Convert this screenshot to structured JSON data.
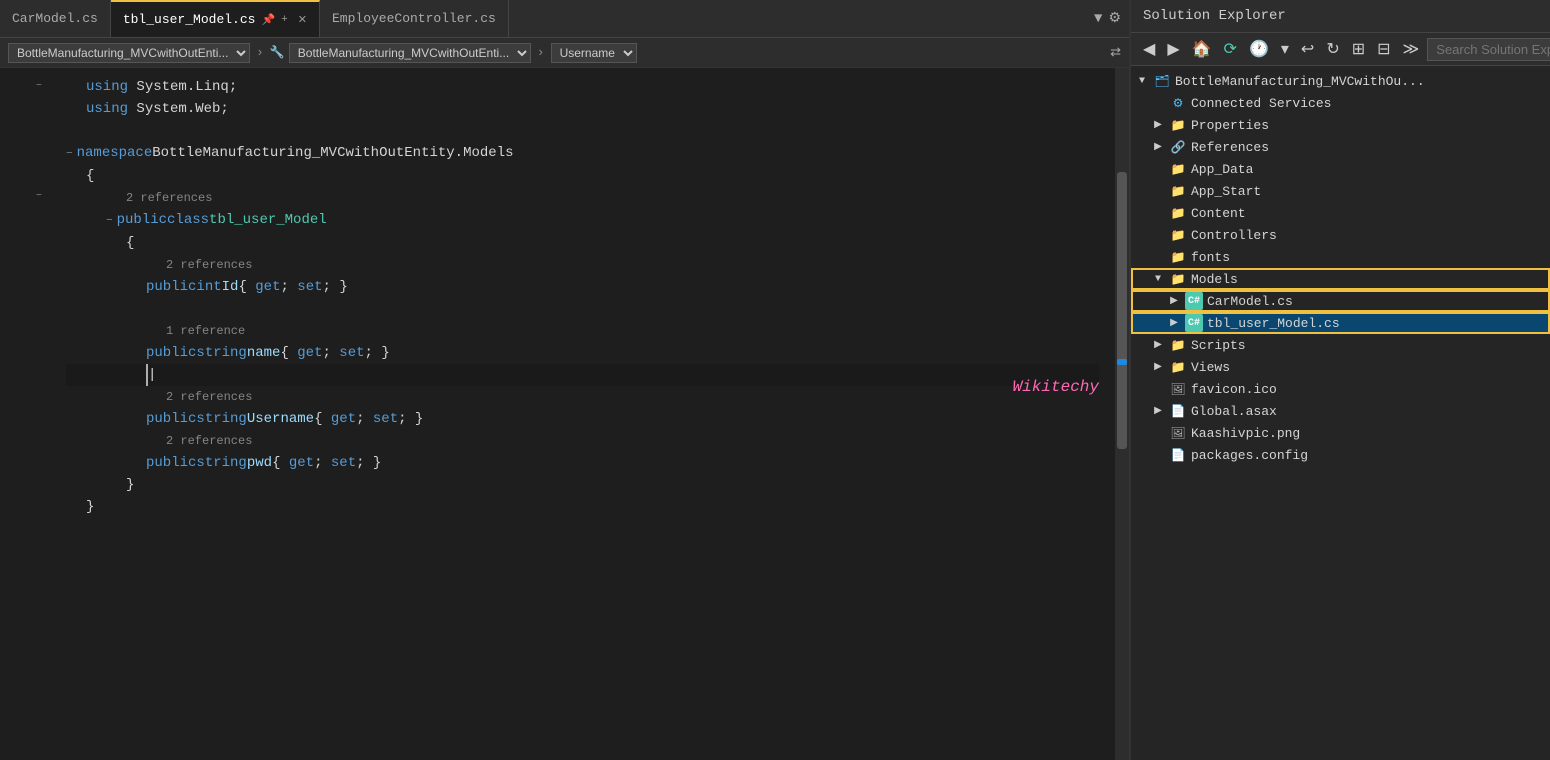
{
  "tabs": [
    {
      "id": "car-model",
      "label": "CarModel.cs",
      "active": false,
      "pinned": false
    },
    {
      "id": "tbl-user-model",
      "label": "tbl_user_Model.cs",
      "active": true,
      "pinned": true,
      "hasClose": true
    },
    {
      "id": "employee-controller",
      "label": "EmployeeController.cs",
      "active": false,
      "pinned": false
    }
  ],
  "tab_controls": [
    "▼",
    "⚙"
  ],
  "breadcrumb": {
    "left_dropdown": "BottleManufacturing_MVCwithOutEnti...",
    "icon": "🔧",
    "middle_dropdown": "BottleManufacturing_MVCwithOutEnti...",
    "right_dropdown": "Username",
    "nav_icon": "⇄"
  },
  "code_lines": [
    {
      "num": "",
      "text": "using System.Linq;",
      "indent": 0,
      "type": "using"
    },
    {
      "num": "",
      "text": "using System.Web;",
      "indent": 0,
      "type": "using"
    },
    {
      "num": "",
      "text": "",
      "indent": 0,
      "type": "blank"
    },
    {
      "num": "",
      "text": "namespace BottleManufacturing_MVCwithOutEntity.Models",
      "indent": 0,
      "type": "namespace"
    },
    {
      "num": "",
      "text": "{",
      "indent": 0,
      "type": "brace"
    },
    {
      "num": "",
      "text": "2 references",
      "indent": 1,
      "type": "ref"
    },
    {
      "num": "",
      "text": "public class tbl_user_Model",
      "indent": 1,
      "type": "class"
    },
    {
      "num": "",
      "text": "{",
      "indent": 1,
      "type": "brace"
    },
    {
      "num": "",
      "text": "2 references",
      "indent": 2,
      "type": "ref"
    },
    {
      "num": "",
      "text": "public int Id { get; set; }",
      "indent": 2,
      "type": "property_int"
    },
    {
      "num": "",
      "text": "",
      "indent": 0,
      "type": "blank"
    },
    {
      "num": "",
      "text": "1 reference",
      "indent": 2,
      "type": "ref"
    },
    {
      "num": "",
      "text": "public string name { get; set; }",
      "indent": 2,
      "type": "property_str"
    },
    {
      "num": "",
      "text": "|",
      "indent": 2,
      "type": "cursor"
    },
    {
      "num": "",
      "text": "2 references",
      "indent": 2,
      "type": "ref"
    },
    {
      "num": "",
      "text": "public string Username { get; set; }",
      "indent": 2,
      "type": "property_str"
    },
    {
      "num": "",
      "text": "2 references",
      "indent": 2,
      "type": "ref"
    },
    {
      "num": "",
      "text": "public string pwd { get; set; }",
      "indent": 2,
      "type": "property_str"
    },
    {
      "num": "",
      "text": "}",
      "indent": 1,
      "type": "brace"
    },
    {
      "num": "",
      "text": "}",
      "indent": 0,
      "type": "brace"
    }
  ],
  "solution_explorer": {
    "title": "Solution Explorer",
    "search_placeholder": "Search Solution Explorer (Ctrl+;)",
    "project_name": "BottleManufacturing_MVCwithOu...",
    "items": [
      {
        "id": "connected-services",
        "label": "Connected Services",
        "indent": 1,
        "icon": "gear",
        "expandable": false
      },
      {
        "id": "properties",
        "label": "Properties",
        "indent": 1,
        "icon": "folder",
        "expandable": true
      },
      {
        "id": "references",
        "label": "References",
        "indent": 1,
        "icon": "ref",
        "expandable": true
      },
      {
        "id": "app-data",
        "label": "App_Data",
        "indent": 1,
        "icon": "folder",
        "expandable": false
      },
      {
        "id": "app-start",
        "label": "App_Start",
        "indent": 1,
        "icon": "folder",
        "expandable": false
      },
      {
        "id": "content",
        "label": "Content",
        "indent": 1,
        "icon": "folder",
        "expandable": false
      },
      {
        "id": "controllers",
        "label": "Controllers",
        "indent": 1,
        "icon": "folder",
        "expandable": false
      },
      {
        "id": "fonts",
        "label": "fonts",
        "indent": 1,
        "icon": "folder",
        "expandable": false
      },
      {
        "id": "models",
        "label": "Models",
        "indent": 1,
        "icon": "folder",
        "expandable": true,
        "highlighted": true
      },
      {
        "id": "carmodel-cs",
        "label": "CarModel.cs",
        "indent": 2,
        "icon": "cs",
        "expandable": true
      },
      {
        "id": "tbl-user-cs",
        "label": "tbl_user_Model.cs",
        "indent": 2,
        "icon": "cs",
        "expandable": true,
        "selected": true
      },
      {
        "id": "scripts",
        "label": "Scripts",
        "indent": 1,
        "icon": "folder",
        "expandable": true
      },
      {
        "id": "views",
        "label": "Views",
        "indent": 1,
        "icon": "folder",
        "expandable": true
      },
      {
        "id": "favicon",
        "label": "favicon.ico",
        "indent": 1,
        "icon": "file",
        "expandable": false
      },
      {
        "id": "global-asax",
        "label": "Global.asax",
        "indent": 1,
        "icon": "file2",
        "expandable": true
      },
      {
        "id": "kaashivpic",
        "label": "Kaashivpic.png",
        "indent": 1,
        "icon": "img",
        "expandable": false
      },
      {
        "id": "packages-config",
        "label": "packages.config",
        "indent": 1,
        "icon": "config",
        "expandable": false
      }
    ]
  },
  "wikitechy": "Wikitechy"
}
